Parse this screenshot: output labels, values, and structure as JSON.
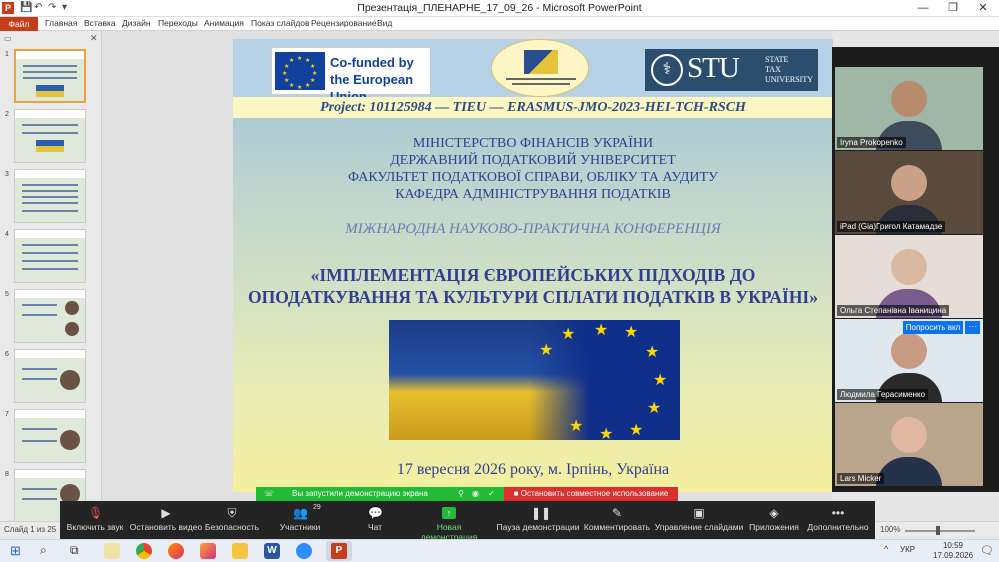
{
  "window": {
    "title": "Презентація_ПЛЕНАРНЕ_17_09_26  -  Microsoft PowerPoint",
    "app_badge": "P",
    "controls": [
      "—",
      "❐",
      "✕"
    ]
  },
  "ribbon": {
    "file": "Файл",
    "tabs": [
      "Главная",
      "Вставка",
      "Дизайн",
      "Переходы",
      "Анимация",
      "Показ слайдов",
      "Рецензирование",
      "Вид"
    ]
  },
  "thumbnails": {
    "numbers": [
      "1",
      "2",
      "3",
      "4",
      "5",
      "6",
      "7",
      "8"
    ],
    "selected": 0
  },
  "slide": {
    "eu_logo": {
      "line1": "Co-funded by",
      "line2": "the European Union"
    },
    "stu_logo": {
      "letters": "STU",
      "line1": "STATE",
      "line2": "TAX",
      "line3": "UNIVERSITY"
    },
    "project": "Project: 101125984 — TIEU — ERASMUS-JMO-2023-HEI-TCH-RSCH",
    "ministry": [
      "МІНІСТЕРСТВО ФІНАНСІВ УКРАЇНИ",
      "ДЕРЖАВНИЙ ПОДАТКОВИЙ УНІВЕРСИТЕТ",
      "ФАКУЛЬТЕТ ПОДАТКОВОЇ СПРАВИ, ОБЛІКУ ТА АУДИТУ",
      "КАФЕДРА АДМІНІСТРУВАННЯ ПОДАТКІВ"
    ],
    "conference_type": "МІЖНАРОДНА НАУКОВО-ПРАКТИЧНА КОНФЕРЕНЦІЯ",
    "conference_title": [
      "«ІМПЛЕМЕНТАЦІЯ ЄВРОПЕЙСЬКИХ ПІДХОДІВ ДО",
      "ОПОДАТКУВАННЯ ТА КУЛЬТУРИ СПЛАТИ ПОДАТКІВ В УКРАЇНІ»"
    ],
    "date": "17 вересня 2026 року, м. Ірпінь, Україна"
  },
  "participants": [
    {
      "name": "Iryna Prokopenko"
    },
    {
      "name": "iPad (Gia)Григол Катамадзе"
    },
    {
      "name": "Ольга Степанівна Іваницина"
    },
    {
      "name": "Людмила Герасименко"
    },
    {
      "name": "Lars Micker"
    }
  ],
  "video_overlay": {
    "request": "Попросить вкл",
    "more": "···"
  },
  "share": {
    "banner": "Вы запустили демонстрацию экрана",
    "stop": "Остановить совместное использование"
  },
  "zoom_toolbar": {
    "participants_count": "29",
    "items": [
      "Включить звук",
      "Остановить видео",
      "Безопасность",
      "Участники",
      "Чат",
      "Новая демонстрация",
      "Пауза демонстрации",
      "Комментировать",
      "Управление слайдами",
      "Приложения",
      "Дополнительно"
    ]
  },
  "status": {
    "slide": "Слайд 1 из 25",
    "zoom": "100%"
  },
  "taskbar": {
    "lang": "УКР",
    "time": "10:59",
    "date": "17.09.2026"
  },
  "colors": {
    "accent_powerpoint": "#c43e1c",
    "zoom_green": "#23ba37",
    "zoom_red": "#dc2f2f",
    "zoom_blue": "#0e72ed"
  }
}
